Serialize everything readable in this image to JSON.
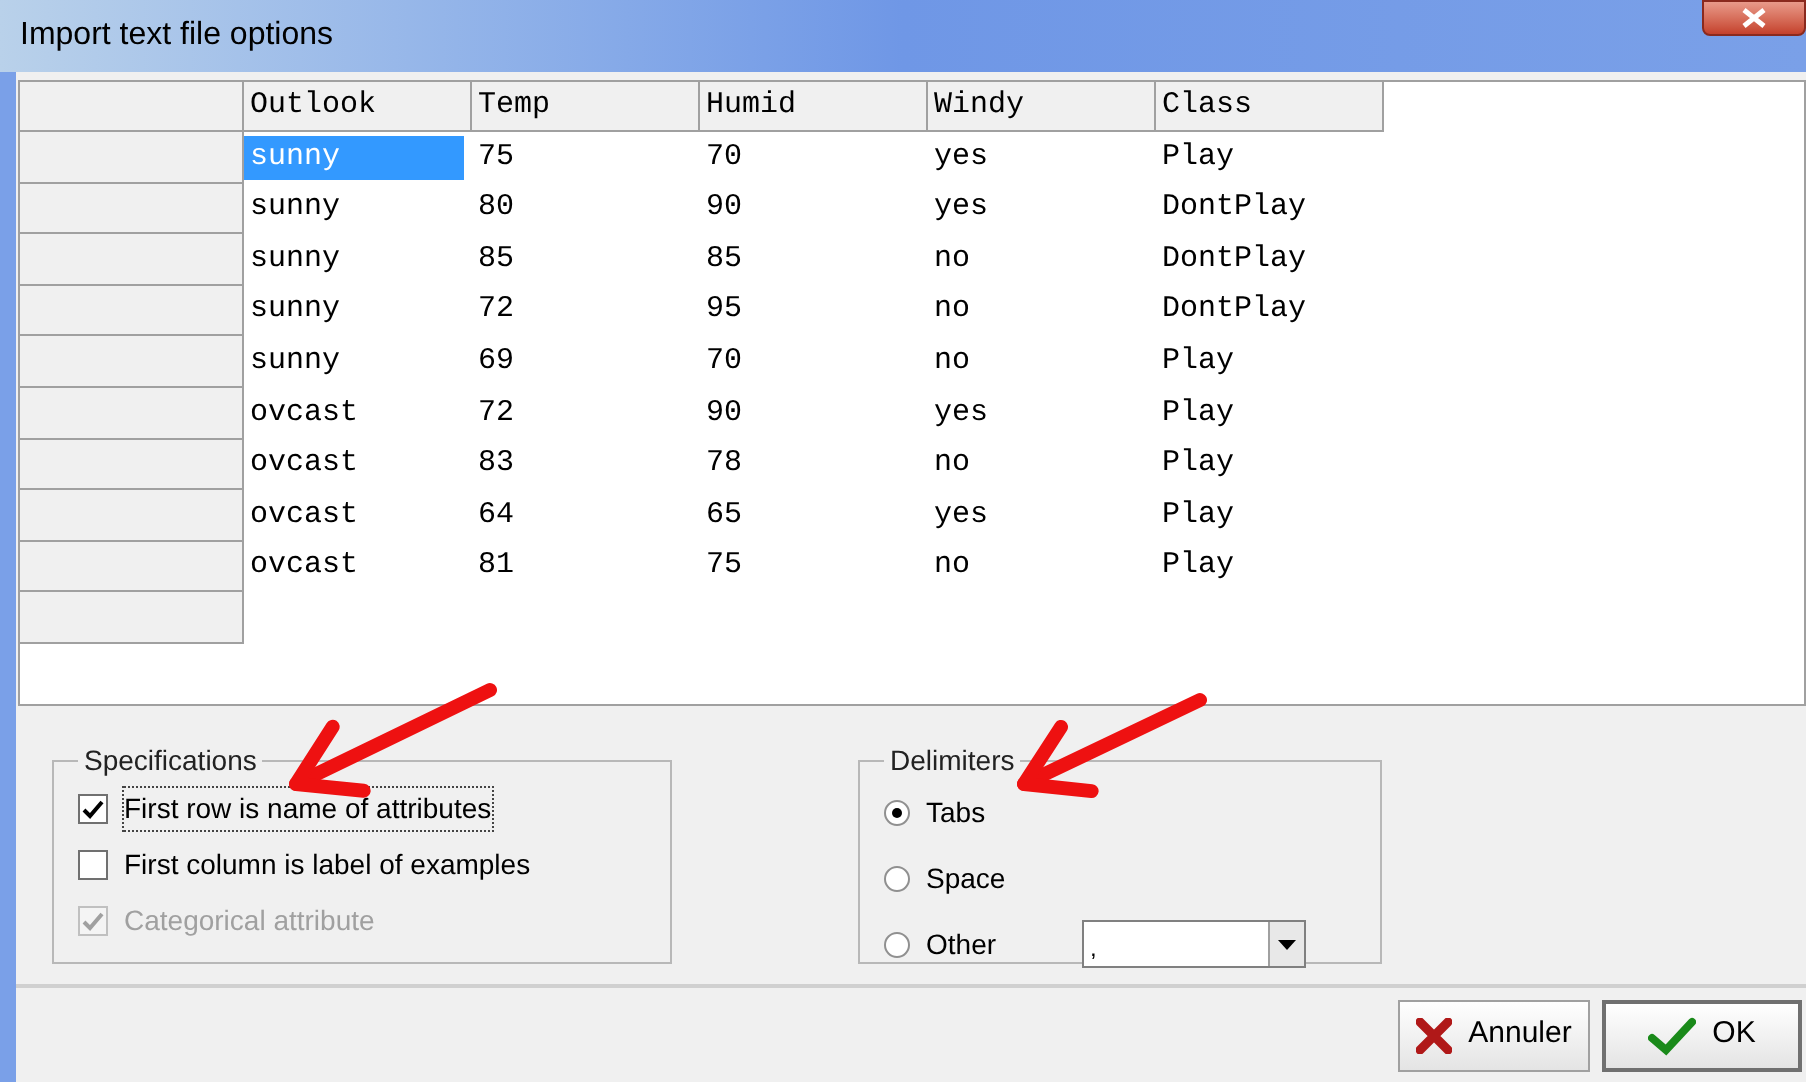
{
  "window": {
    "title": "Import text file options"
  },
  "table": {
    "columns": [
      "Outlook",
      "Temp",
      "Humid",
      "Windy",
      "Class"
    ],
    "rows": [
      {
        "cells": [
          "sunny",
          "75",
          "70",
          "yes",
          "Play"
        ],
        "selected": true
      },
      {
        "cells": [
          "sunny",
          "80",
          "90",
          "yes",
          "DontPlay"
        ],
        "selected": false
      },
      {
        "cells": [
          "sunny",
          "85",
          "85",
          "no",
          "DontPlay"
        ],
        "selected": false
      },
      {
        "cells": [
          "sunny",
          "72",
          "95",
          "no",
          "DontPlay"
        ],
        "selected": false
      },
      {
        "cells": [
          "sunny",
          "69",
          "70",
          "no",
          "Play"
        ],
        "selected": false
      },
      {
        "cells": [
          "ovcast",
          "72",
          "90",
          "yes",
          "Play"
        ],
        "selected": false
      },
      {
        "cells": [
          "ovcast",
          "83",
          "78",
          "no",
          "Play"
        ],
        "selected": false
      },
      {
        "cells": [
          "ovcast",
          "64",
          "65",
          "yes",
          "Play"
        ],
        "selected": false
      },
      {
        "cells": [
          "ovcast",
          "81",
          "75",
          "no",
          "Play"
        ],
        "selected": false
      }
    ]
  },
  "specifications": {
    "title": "Specifications",
    "options": [
      {
        "label": "First row is name of attributes",
        "checked": true,
        "disabled": false
      },
      {
        "label": "First column is label of examples",
        "checked": false,
        "disabled": false
      },
      {
        "label": "Categorical attribute",
        "checked": true,
        "disabled": true
      }
    ]
  },
  "delimiters": {
    "title": "Delimiters",
    "options": [
      {
        "label": "Tabs",
        "selected": true
      },
      {
        "label": "Space",
        "selected": false
      },
      {
        "label": "Other",
        "selected": false
      }
    ],
    "other_value": ","
  },
  "buttons": [
    {
      "label": "Annuler",
      "kind": "cancel"
    },
    {
      "label": "OK",
      "kind": "ok"
    }
  ]
}
